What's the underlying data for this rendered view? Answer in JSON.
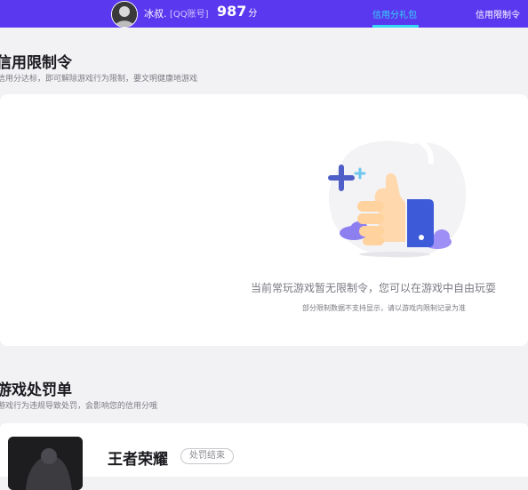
{
  "header": {
    "nickname": "冰叔.",
    "account_label": "[QQ账号]",
    "score": "987",
    "score_unit": "分",
    "nav": [
      {
        "label": "信用分礼包",
        "active": true
      },
      {
        "label": "信用限制令",
        "active": false
      }
    ]
  },
  "restriction": {
    "title": "信用限制令",
    "subtitle": "信用分达标，即可解除游戏行为限制，要文明健康地游戏",
    "empty_message": "当前常玩游戏暂无限制令，您可以在游戏中自由玩耍",
    "empty_note": "部分限制数据不支持显示，请以游戏内限制记录为准"
  },
  "penalty": {
    "title": "游戏处罚单",
    "subtitle": "游戏行为违规导致处罚，会影响您的信用分哦",
    "items": [
      {
        "game": "王者荣耀",
        "status": "处罚结束"
      }
    ]
  },
  "colors": {
    "topbar": "#5a38f0",
    "nav_active": "#33d6f5",
    "thumb_blue": "#3d5bd9"
  }
}
